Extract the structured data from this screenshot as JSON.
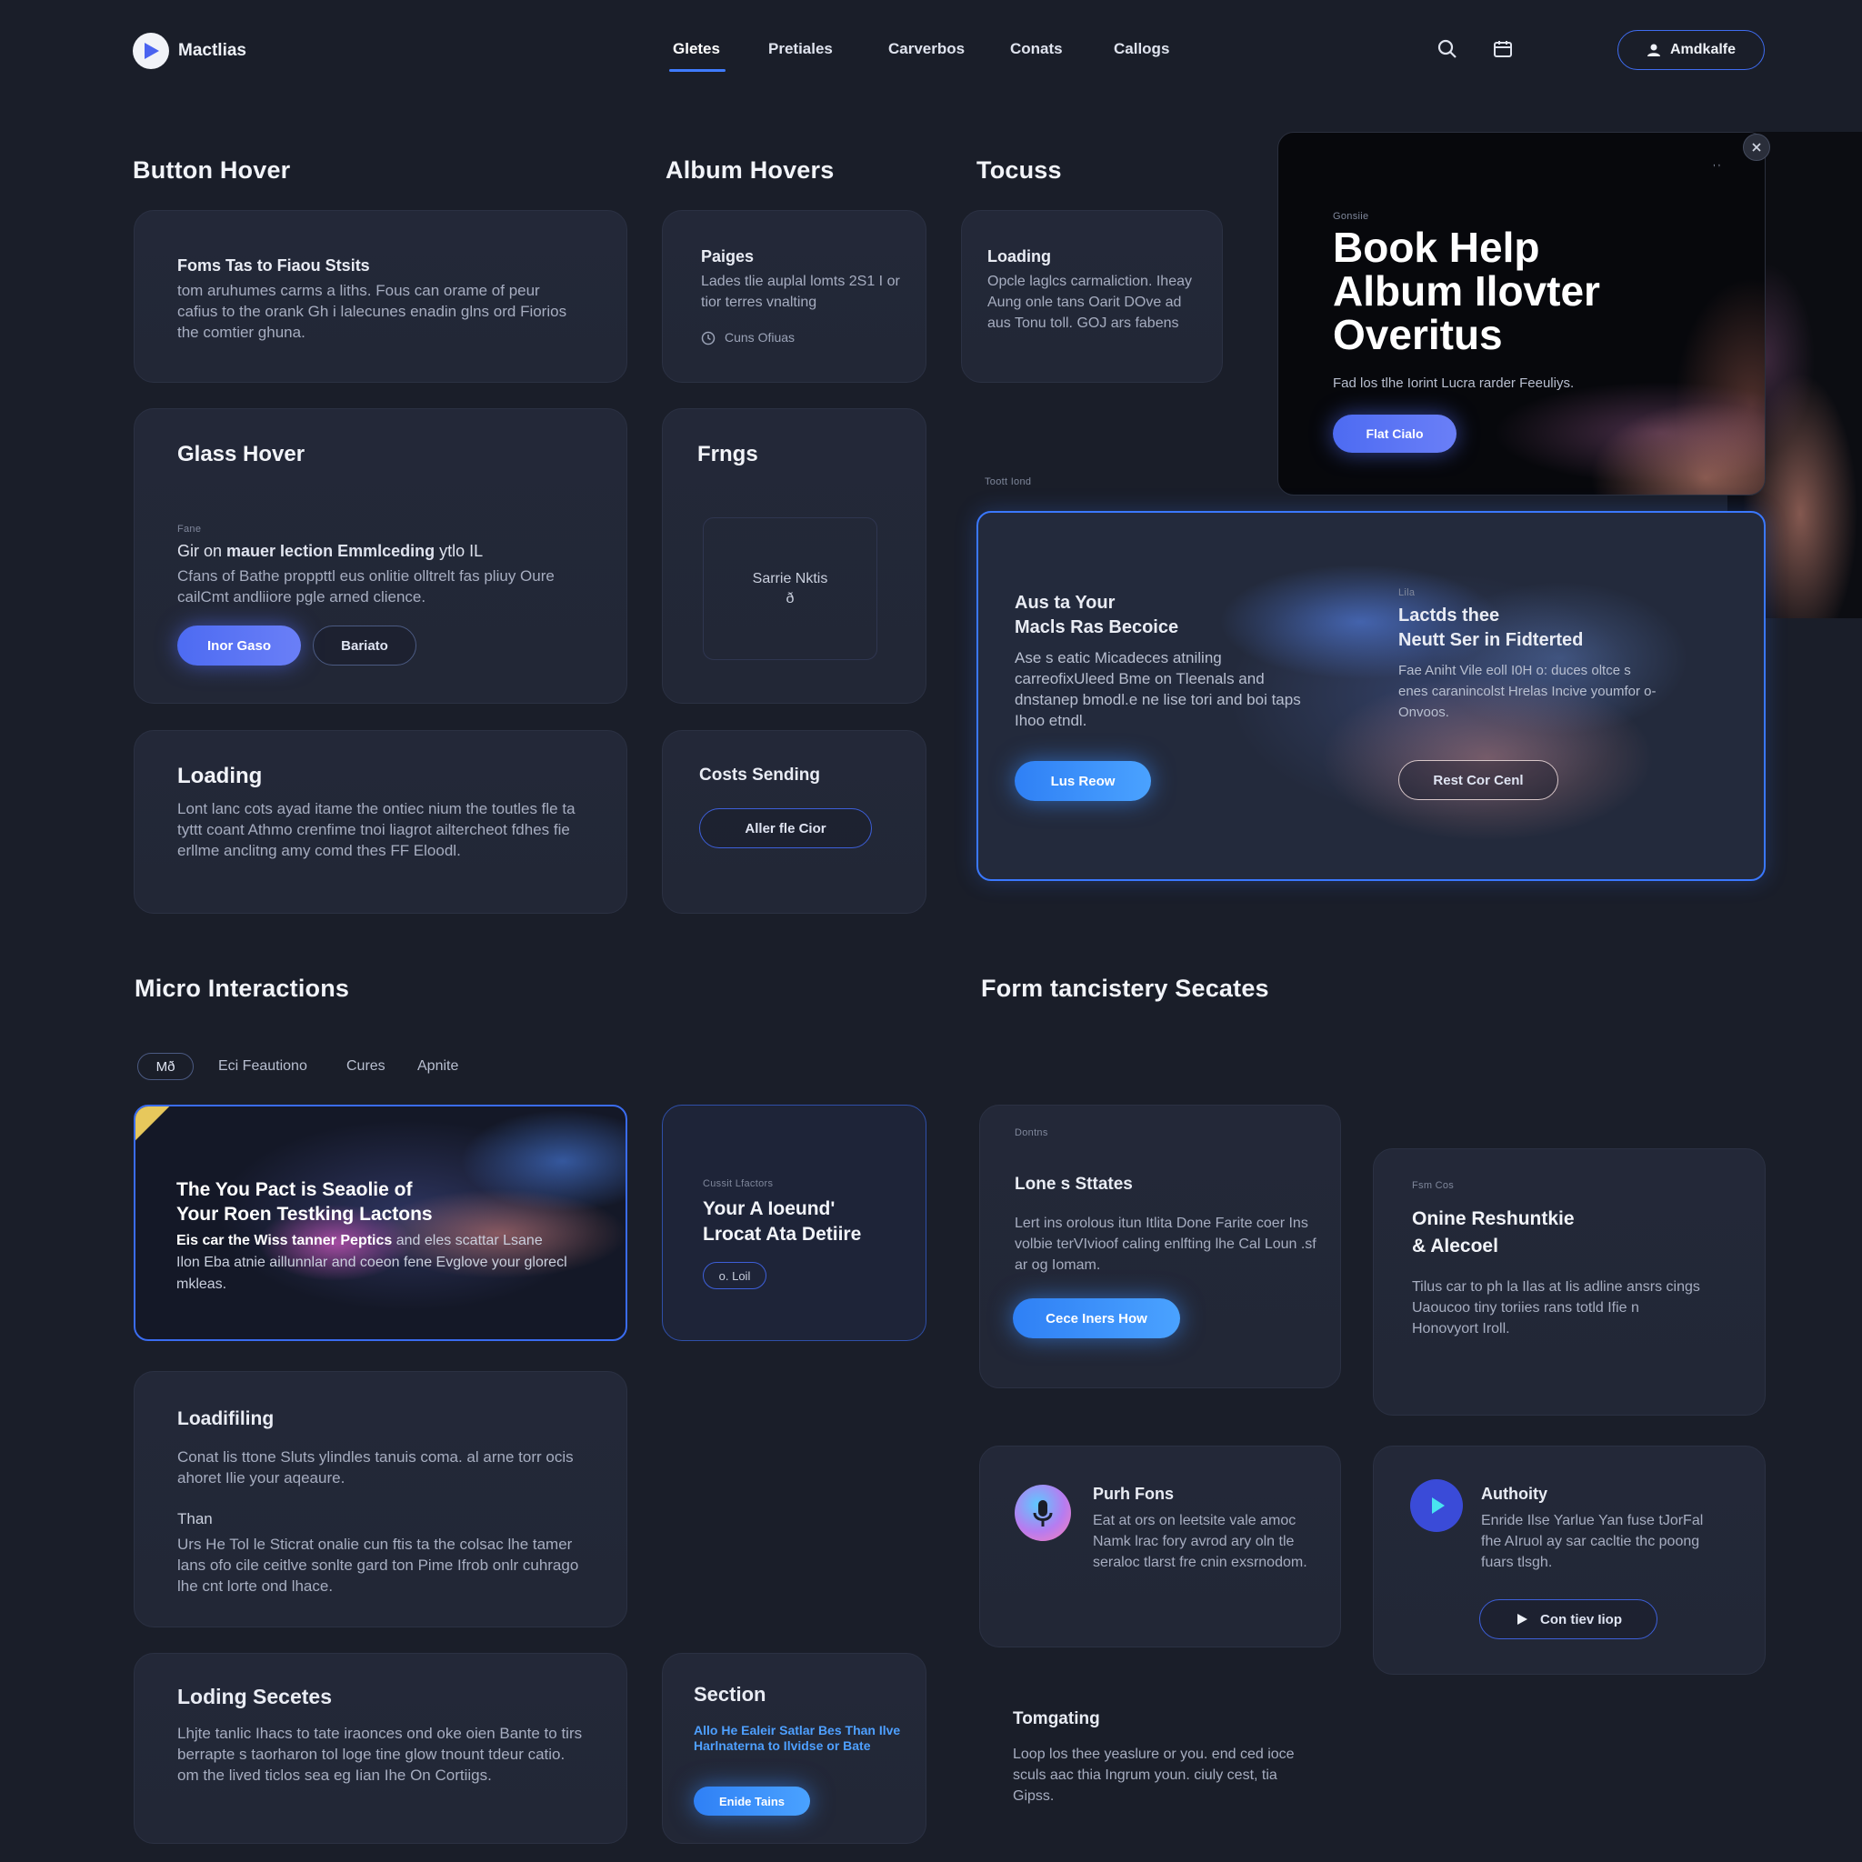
{
  "nav": {
    "brand": "Mactlias",
    "links": [
      "Gletes",
      "Pretiales",
      "Carverbos",
      "Conats",
      "Callogs"
    ],
    "account_label": "Amdkalfe"
  },
  "sections": {
    "button_hover": "Button Hover",
    "album_hovers": "Album Hovers",
    "tocuss": "Tocuss",
    "micro_interactions": "Micro Interactions",
    "form_states": "Form tancistery Secates"
  },
  "card_button_hover": {
    "title": "Foms Tas to Fiaou Stsits",
    "body": "tom aruhumes carms a liths. Fous can orame of peur cafius to the orank Gh i lalecunes enadin glns ord Fiorios the comtier ghuna."
  },
  "card_pages": {
    "title": "Paiges",
    "body": "Lades tlie auplal lomts 2S1 I or tior terres vnalting",
    "meta": "Cuns Ofiuas"
  },
  "card_loading_top": {
    "title": "Loading",
    "body": "Opcle laglcs carmaliction. Iheay Aung onle tans Oarit DOve ad aus Tonu toll. GOJ ars fabens"
  },
  "card_glass": {
    "title": "Glass Hover",
    "eyebrow": "Fane",
    "lead_plain": "Gir on ",
    "lead_bold": "mauer Iection Emmlceding",
    "lead_tail": " ytlo IL",
    "body": "Cfans of Bathe proppttl eus onlitie olltrelt fas pliuy Oure cailCmt andliiore pgle arned clience.",
    "primary_label": "Inor Gaso",
    "secondary_label": "Bariato"
  },
  "card_frngs": {
    "title": "Frngs",
    "inner_text": "Sarrie Nktis",
    "inner_glyph": "ð"
  },
  "card_loading_mid": {
    "title": "Loading",
    "body": "Lont lanc cots ayad itame the ontiec nium the toutles fle ta tyttt coant Athmo crenfime tnoi liagrot ailtercheot fdhes fie erllme anclitng amy comd thes FF Eloodl."
  },
  "card_costs": {
    "title": "Costs Sending",
    "button_label": "Aller fle Cior"
  },
  "hero_modal": {
    "eyebrow": "Gonsiie",
    "title_line1": "Book Help",
    "title_line2": "Album Ilovter",
    "title_line3": "Overitus",
    "subtitle": "Fad los tlhe Iorint Lucra rarder Feeuliys.",
    "button_label": "Flat Cialo",
    "corner_text": ", ,"
  },
  "feature": {
    "caption": "Toott Iond",
    "left_title_line1": "Aus ta Your",
    "left_title_line2": "Macls Ras Becoice",
    "left_body": "Ase s eatic Micadeces atniling carreofixUleed Bme on Tleenals and dnstanep bmodl.e ne lise tori and boi taps Ihoo etndl.",
    "left_button": "Lus Reow",
    "right_eyebrow": "Lila",
    "right_title_line1": "Lactds thee",
    "right_title_line2": "Neutt Ser in Fidterted",
    "right_body": "Fae Aniht Vile eoll I0H o: duces oltce s enes caranincolst Hrelas Incive youmfor o-Onvoos.",
    "right_button": "Rest Cor Cenl"
  },
  "micro": {
    "tabs": [
      "Mð",
      "Eci Feautiono",
      "Cures",
      "Apnite"
    ],
    "feature_title_line1": "The You Pact is Seaolie of",
    "feature_title_line2": "Your Roen Testking Lactons",
    "feature_body_bold": "Eis car the Wiss tanner Peptics",
    "feature_body_rest": " and eles scattar Lsane Ilon Eba atnie aillunnlar and coeon fene Evglove your glorecl mkleas.",
    "side_eyebrow": "Cussit Lfactors",
    "side_title_line1": "Your A Ioeund'",
    "side_title_line2": "Lrocat Ata Detiire",
    "side_chip": "o. Loil"
  },
  "card_loadiling": {
    "title": "Loadifiling",
    "body1": "Conat lis ttone Sluts ylindles tanuis coma. al arne torr ocis ahoret Ilie your aqeaure.",
    "subhead": "Than",
    "body2": "Urs He Tol le Sticrat onalie cun ftis ta the colsac lhe tamer lans ofo cile ceitlve sonlte gard ton Pime Ifrob onlr cuhrago lhe cnt lorte ond lhace."
  },
  "card_loading_secrets": {
    "title": "Loding Secetes",
    "body": "Lhjte tanlic Ihacs to tate iraonces ond oke oien Bante to tirs berrapte s taorharon tol loge tine glow tnount tdeur catio. om the lived ticlos sea eg Iian Ihe On Cortiigs."
  },
  "card_section": {
    "title": "Section",
    "blue_text": "Allo He Ealeir Satlar Bes Than Ilve Harlnaterna to Ilvidse or Bate",
    "button_label": "Enide Tains"
  },
  "form_lone": {
    "eyebrow": "Dontns",
    "title": "Lone s Sttates",
    "body": "Lert ins orolous itun Itlita Done Farite coer Ins volbie terVIvioof caling enlfting lhe Cal Loun .sf ar og Iomam.",
    "button_label": "Cece Iners How"
  },
  "form_online": {
    "eyebrow": "Fsm Cos",
    "title_line1": "Onine Reshuntkie",
    "title_line2": "& Alecoel",
    "body": "Tilus car to ph la Ilas at Iis adline ansrs cings Uaoucoo tiny toriies rans totld Ifie n Honovyort Iroll."
  },
  "form_push": {
    "title": "Purh Fons",
    "body": "Eat at ors on leetsite vale amoc Namk lrac fory avrod ary oln tle seraloc tlarst fre cnin exsrnodom."
  },
  "form_authority": {
    "title": "Authoity",
    "body": "Enride Ilse Yarlue Yan fuse tJorFal fhe AIruol ay sar cacltie thc poong fuars tlsgh.",
    "button_label": "Con tiev Iiop"
  },
  "form_tomgating": {
    "title": "Tomgating",
    "body": "Loop los thee yeaslure or you. end ced ioce sculs aac thia Ingrum youn. ciuly cest, tia Gipss."
  },
  "colors": {
    "background": "#1a1e29",
    "card": "#222736",
    "accent_blue": "#3a78ff",
    "accent_indigo": "#5a72f5"
  }
}
